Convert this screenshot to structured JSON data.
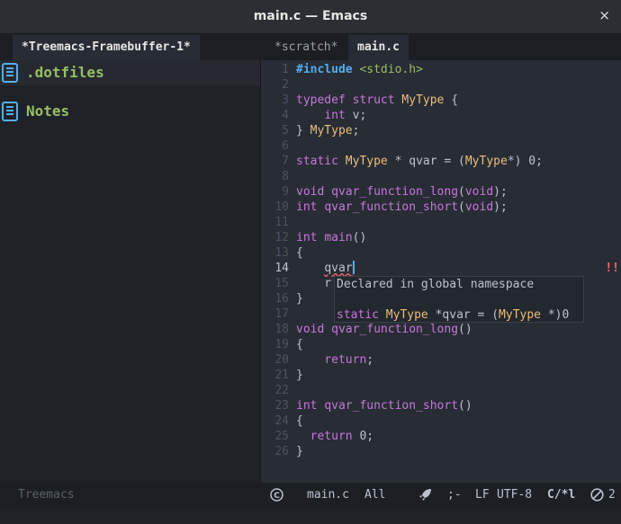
{
  "window": {
    "title": "main.c — Emacs",
    "close_glyph": "×"
  },
  "tabs": {
    "left": [
      {
        "label": "*Treemacs-Framebuffer-1*",
        "active": true
      }
    ],
    "right": [
      {
        "label": "*scratch*",
        "active": false
      },
      {
        "label": "main.c",
        "active": true
      }
    ]
  },
  "treemacs": {
    "items": [
      {
        "label": ".dotfiles",
        "icon": "book-icon",
        "highlighted": true
      },
      {
        "label": "Notes",
        "icon": "book-icon",
        "highlighted": false
      }
    ]
  },
  "editor": {
    "line_numbers": [
      "1",
      "2",
      "3",
      "4",
      "5",
      "6",
      "7",
      "8",
      "9",
      "10",
      "11",
      "12",
      "13",
      "14",
      "15",
      "16",
      "17",
      "18",
      "19",
      "20",
      "21",
      "22",
      "23",
      "24",
      "25",
      "26"
    ],
    "error_marker": "!!",
    "popup": {
      "line1": "Declared in global namespace",
      "line2": "static MyType *qvar = (MyType *)0"
    }
  },
  "modeline": {
    "left_label": "Treemacs",
    "file": "main.c",
    "position": "All",
    "separator": ";-",
    "eol": "LF",
    "encoding": "UTF-8",
    "mode": "C/*l",
    "count": "2"
  },
  "colors": {
    "keyword": "#c678dd",
    "type": "#ECBE7B",
    "string": "#98be65",
    "accent": "#51afef",
    "error": "#ff6c6b"
  }
}
